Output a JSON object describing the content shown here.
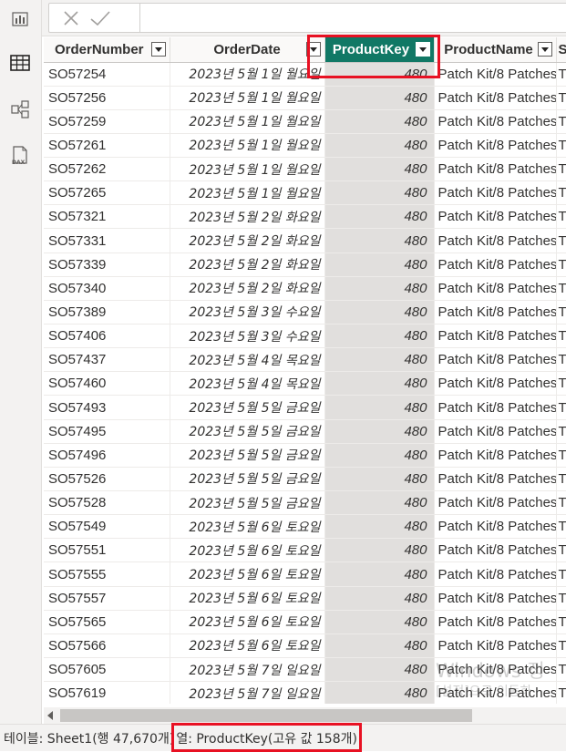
{
  "rail": {
    "icons": [
      "report-view-icon",
      "table-view-icon",
      "model-view-icon",
      "dax-query-icon"
    ],
    "dax_label": "DAX"
  },
  "toolbar": {
    "cancel_icon": "close-icon",
    "commit_icon": "check-icon"
  },
  "table": {
    "columns": [
      "OrderNumber",
      "OrderDate",
      "ProductKey",
      "ProductName",
      "S"
    ],
    "selected_column": "ProductKey",
    "rows": [
      [
        "SO57254",
        "2023년 5월 1일 월요일",
        "480",
        "Patch Kit/8 Patches",
        "T"
      ],
      [
        "SO57256",
        "2023년 5월 1일 월요일",
        "480",
        "Patch Kit/8 Patches",
        "T"
      ],
      [
        "SO57259",
        "2023년 5월 1일 월요일",
        "480",
        "Patch Kit/8 Patches",
        "T"
      ],
      [
        "SO57261",
        "2023년 5월 1일 월요일",
        "480",
        "Patch Kit/8 Patches",
        "T"
      ],
      [
        "SO57262",
        "2023년 5월 1일 월요일",
        "480",
        "Patch Kit/8 Patches",
        "T"
      ],
      [
        "SO57265",
        "2023년 5월 1일 월요일",
        "480",
        "Patch Kit/8 Patches",
        "T"
      ],
      [
        "SO57321",
        "2023년 5월 2일 화요일",
        "480",
        "Patch Kit/8 Patches",
        "T"
      ],
      [
        "SO57331",
        "2023년 5월 2일 화요일",
        "480",
        "Patch Kit/8 Patches",
        "T"
      ],
      [
        "SO57339",
        "2023년 5월 2일 화요일",
        "480",
        "Patch Kit/8 Patches",
        "T"
      ],
      [
        "SO57340",
        "2023년 5월 2일 화요일",
        "480",
        "Patch Kit/8 Patches",
        "T"
      ],
      [
        "SO57389",
        "2023년 5월 3일 수요일",
        "480",
        "Patch Kit/8 Patches",
        "T"
      ],
      [
        "SO57406",
        "2023년 5월 3일 수요일",
        "480",
        "Patch Kit/8 Patches",
        "T"
      ],
      [
        "SO57437",
        "2023년 5월 4일 목요일",
        "480",
        "Patch Kit/8 Patches",
        "T"
      ],
      [
        "SO57460",
        "2023년 5월 4일 목요일",
        "480",
        "Patch Kit/8 Patches",
        "T"
      ],
      [
        "SO57493",
        "2023년 5월 5일 금요일",
        "480",
        "Patch Kit/8 Patches",
        "T"
      ],
      [
        "SO57495",
        "2023년 5월 5일 금요일",
        "480",
        "Patch Kit/8 Patches",
        "T"
      ],
      [
        "SO57496",
        "2023년 5월 5일 금요일",
        "480",
        "Patch Kit/8 Patches",
        "T"
      ],
      [
        "SO57526",
        "2023년 5월 5일 금요일",
        "480",
        "Patch Kit/8 Patches",
        "T"
      ],
      [
        "SO57528",
        "2023년 5월 5일 금요일",
        "480",
        "Patch Kit/8 Patches",
        "T"
      ],
      [
        "SO57549",
        "2023년 5월 6일 토요일",
        "480",
        "Patch Kit/8 Patches",
        "T"
      ],
      [
        "SO57551",
        "2023년 5월 6일 토요일",
        "480",
        "Patch Kit/8 Patches",
        "T"
      ],
      [
        "SO57555",
        "2023년 5월 6일 토요일",
        "480",
        "Patch Kit/8 Patches",
        "T"
      ],
      [
        "SO57557",
        "2023년 5월 6일 토요일",
        "480",
        "Patch Kit/8 Patches",
        "T"
      ],
      [
        "SO57565",
        "2023년 5월 6일 토요일",
        "480",
        "Patch Kit/8 Patches",
        "T"
      ],
      [
        "SO57566",
        "2023년 5월 6일 토요일",
        "480",
        "Patch Kit/8 Patches",
        "T"
      ],
      [
        "SO57605",
        "2023년 5월 7일 일요일",
        "480",
        "Patch Kit/8 Patches",
        "T"
      ],
      [
        "SO57619",
        "2023년 5월 7일 일요일",
        "480",
        "Patch Kit/8 Patches",
        "T"
      ]
    ]
  },
  "status": {
    "table_info": "테이블: Sheet1(행 47,670개)",
    "column_info": "열: ProductKey(고유 값 158개)"
  },
  "watermark": {
    "line1": "Windows 정",
    "line2": "[설정]으로 이동하"
  },
  "colors": {
    "selected_header": "#117865",
    "highlight": "#e81123",
    "selected_column_fill": "#e1dfdd"
  }
}
